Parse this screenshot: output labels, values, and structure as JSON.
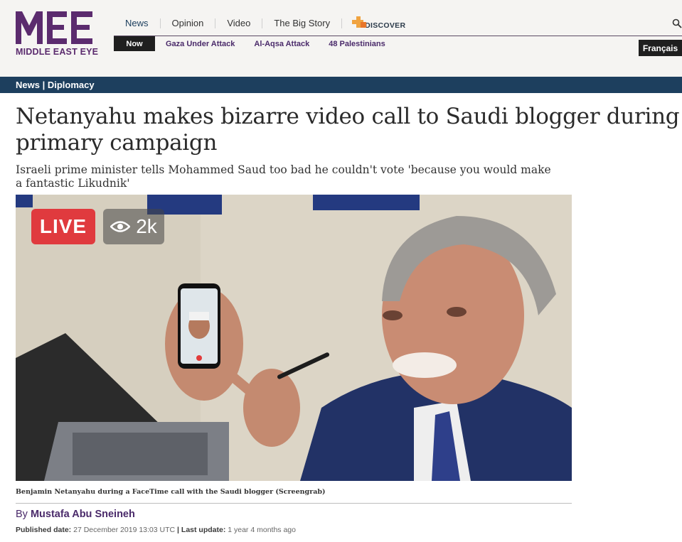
{
  "site": {
    "logo_mark": "MEE",
    "logo_text": "MIDDLE EAST EYE",
    "brand_color": "#5b2b6e"
  },
  "topnav": {
    "items": [
      "News",
      "Opinion",
      "Video",
      "The Big Story"
    ],
    "discover_label": "DISCOVER"
  },
  "subnav": {
    "now_label": "Now",
    "items": [
      "Gaza Under Attack",
      "Al-Aqsa Attack",
      "48 Palestinians"
    ]
  },
  "language_button": "Français",
  "breadcrumb": "News | Diplomacy",
  "article": {
    "headline": "Netanyahu makes bizarre video call to Saudi blogger during primary campaign",
    "standfirst": "Israeli prime minister tells Mohammed Saud too bad he couldn't vote 'because you would make a fantastic Likudnik'",
    "image": {
      "live_label": "LIVE",
      "views_label": "2k"
    },
    "caption": "Benjamin Netanyahu during a FaceTime call with the Saudi blogger (Screengrab)",
    "byline_prefix": "By",
    "author": "Mustafa Abu Sneineh",
    "published_label": "Published date:",
    "published_value": "27 December 2019 13:03 UTC",
    "separator": "|",
    "updated_label": "Last update:",
    "updated_value": "1 year 4 months ago"
  },
  "colors": {
    "section_bar": "#1d3f5e",
    "live_red": "#e03a3e",
    "header_bg": "#f5f4f2"
  }
}
